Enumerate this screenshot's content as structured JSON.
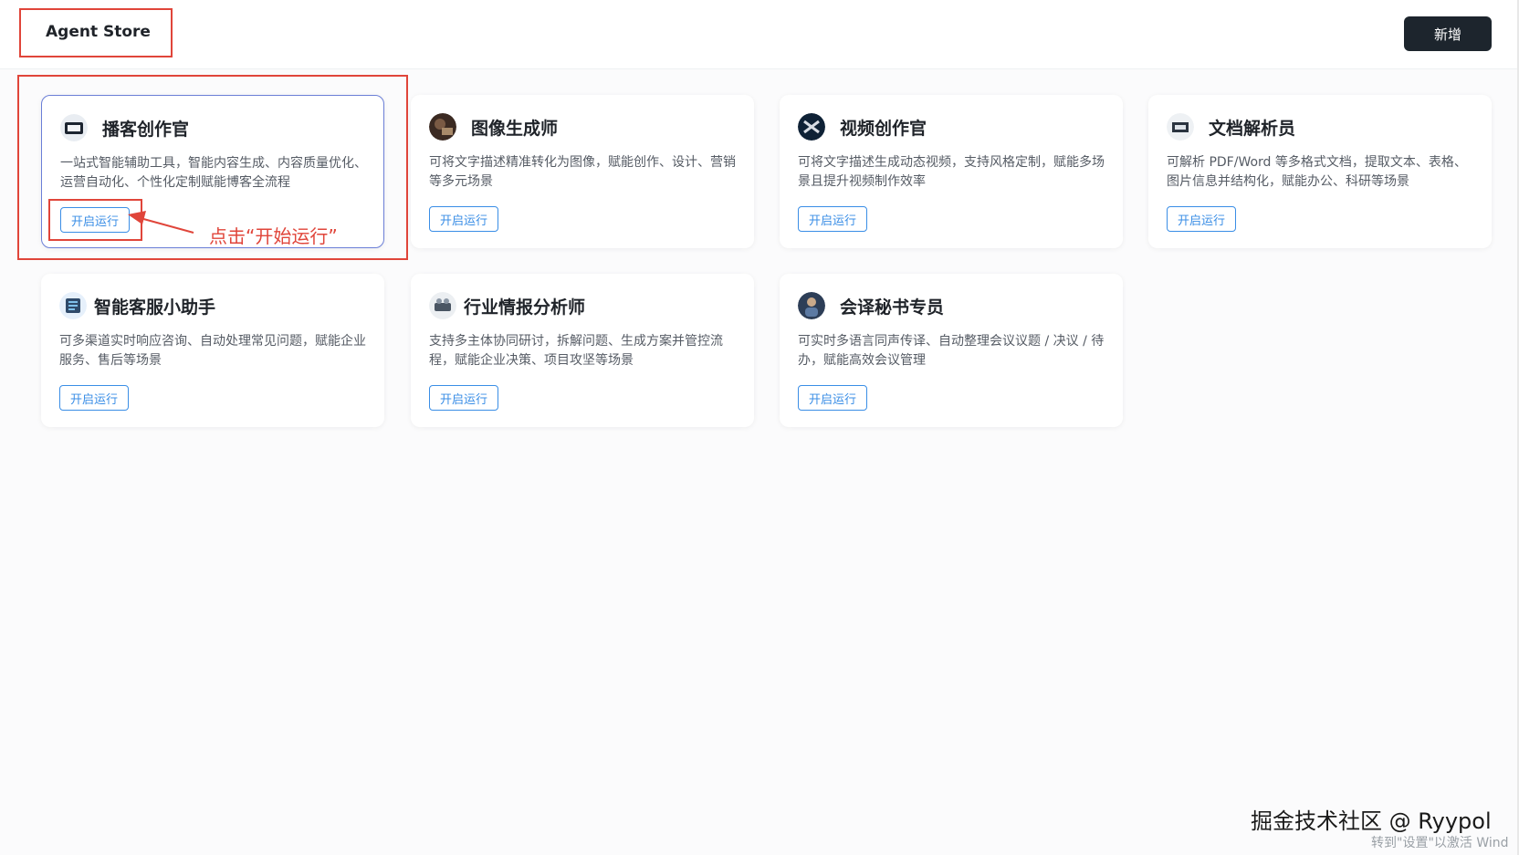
{
  "header": {
    "title": "Agent Store",
    "add_button": "新增"
  },
  "cards": [
    {
      "name": "播客创作官",
      "desc": "一站式智能辅助工具，智能内容生成、内容质量优化、运营自动化、个性化定制赋能博客全流程",
      "button": "开启运行",
      "icon": "podcast-icon"
    },
    {
      "name": "图像生成师",
      "desc": "可将文字描述精准转化为图像，赋能创作、设计、营销等多元场景",
      "button": "开启运行",
      "icon": "image-gen-icon"
    },
    {
      "name": "视频创作官",
      "desc": "可将文字描述生成动态视频，支持风格定制，赋能多场景且提升视频制作效率",
      "button": "开启运行",
      "icon": "video-icon"
    },
    {
      "name": "文档解析员",
      "desc": "可解析 PDF/Word 等多格式文档，提取文本、表格、图片信息并结构化，赋能办公、科研等场景",
      "button": "开启运行",
      "icon": "document-icon"
    },
    {
      "name": "智能客服小助手",
      "desc": "可多渠道实时响应咨询、自动处理常见问题，赋能企业服务、售后等场景",
      "button": "开启运行",
      "icon": "customer-service-icon"
    },
    {
      "name": "行业情报分析师",
      "desc": "支持多主体协同研讨，拆解问题、生成方案并管控流程，赋能企业决策、项目攻坚等场景",
      "button": "开启运行",
      "icon": "analysis-icon"
    },
    {
      "name": "会译秘书专员",
      "desc": "可实时多语言同声传译、自动整理会议议题 / 决议 / 待办，赋能高效会议管理",
      "button": "开启运行",
      "icon": "interpreter-icon"
    }
  ],
  "annotation": {
    "text": "点击“开始运行”"
  },
  "watermark": {
    "text": "掘金技术社区 @ Ryypol",
    "activate": "转到\"设置\"以激活 Wind"
  },
  "colors": {
    "accent": "#3a8ee6",
    "annotation": "#e0453a",
    "dark_button": "#1d252d",
    "selected_border": "#6b7fd7"
  }
}
